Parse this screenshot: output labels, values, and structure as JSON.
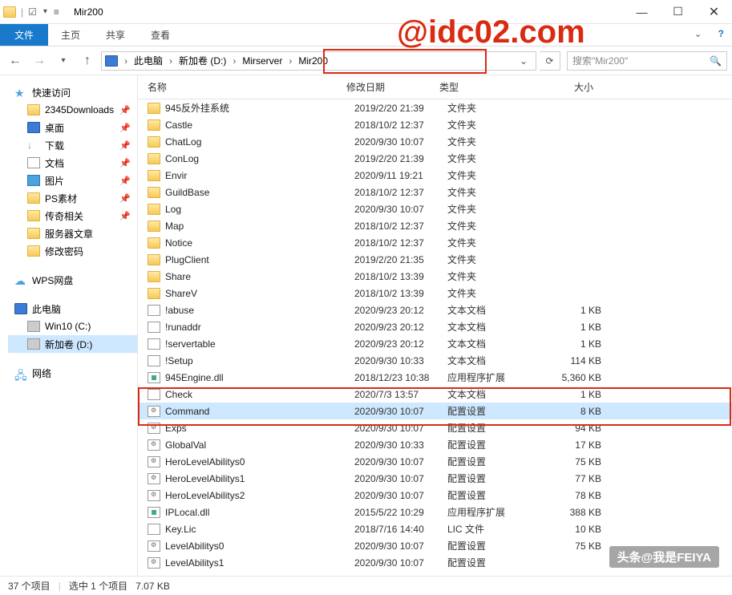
{
  "window": {
    "title": "Mir200"
  },
  "ribbon": {
    "file": "文件",
    "home": "主页",
    "share": "共享",
    "view": "查看"
  },
  "breadcrumb": {
    "pc": "此电脑",
    "drive": "新加卷 (D:)",
    "p1": "Mirserver",
    "p2": "Mir200"
  },
  "search": {
    "placeholder": "搜索\"Mir200\""
  },
  "sidebar": {
    "quick": "快速访问",
    "items1": [
      "2345Downloads",
      "桌面",
      "下载",
      "文档",
      "图片",
      "PS素材",
      "传奇相关",
      "服务器文章",
      "修改密码"
    ],
    "wps": "WPS网盘",
    "thispc": "此电脑",
    "drives": [
      "Win10 (C:)",
      "新加卷 (D:)"
    ],
    "network": "网络"
  },
  "columns": {
    "name": "名称",
    "date": "修改日期",
    "type": "类型",
    "size": "大小"
  },
  "types": {
    "folder": "文件夹",
    "txt": "文本文档",
    "dll": "应用程序扩展",
    "cfg": "配置设置",
    "lic": "LIC 文件"
  },
  "files": [
    {
      "icon": "folder",
      "name": "945反外挂系统",
      "date": "2019/2/20 21:39",
      "typekey": "folder",
      "size": ""
    },
    {
      "icon": "folder",
      "name": "Castle",
      "date": "2018/10/2 12:37",
      "typekey": "folder",
      "size": ""
    },
    {
      "icon": "folder",
      "name": "ChatLog",
      "date": "2020/9/30 10:07",
      "typekey": "folder",
      "size": ""
    },
    {
      "icon": "folder",
      "name": "ConLog",
      "date": "2019/2/20 21:39",
      "typekey": "folder",
      "size": ""
    },
    {
      "icon": "folder",
      "name": "Envir",
      "date": "2020/9/11 19:21",
      "typekey": "folder",
      "size": ""
    },
    {
      "icon": "folder",
      "name": "GuildBase",
      "date": "2018/10/2 12:37",
      "typekey": "folder",
      "size": ""
    },
    {
      "icon": "folder",
      "name": "Log",
      "date": "2020/9/30 10:07",
      "typekey": "folder",
      "size": ""
    },
    {
      "icon": "folder",
      "name": "Map",
      "date": "2018/10/2 12:37",
      "typekey": "folder",
      "size": ""
    },
    {
      "icon": "folder",
      "name": "Notice",
      "date": "2018/10/2 12:37",
      "typekey": "folder",
      "size": ""
    },
    {
      "icon": "folder",
      "name": "PlugClient",
      "date": "2019/2/20 21:35",
      "typekey": "folder",
      "size": ""
    },
    {
      "icon": "folder",
      "name": "Share",
      "date": "2018/10/2 13:39",
      "typekey": "folder",
      "size": ""
    },
    {
      "icon": "folder",
      "name": "ShareV",
      "date": "2018/10/2 13:39",
      "typekey": "folder",
      "size": ""
    },
    {
      "icon": "txt",
      "name": "!abuse",
      "date": "2020/9/23 20:12",
      "typekey": "txt",
      "size": "1 KB"
    },
    {
      "icon": "txt",
      "name": "!runaddr",
      "date": "2020/9/23 20:12",
      "typekey": "txt",
      "size": "1 KB"
    },
    {
      "icon": "txt",
      "name": "!servertable",
      "date": "2020/9/23 20:12",
      "typekey": "txt",
      "size": "1 KB"
    },
    {
      "icon": "txt",
      "name": "!Setup",
      "date": "2020/9/30 10:33",
      "typekey": "txt",
      "size": "114 KB"
    },
    {
      "icon": "dll",
      "name": "945Engine.dll",
      "date": "2018/12/23 10:38",
      "typekey": "dll",
      "size": "5,360 KB"
    },
    {
      "icon": "txt",
      "name": "Check",
      "date": "2020/7/3 13:57",
      "typekey": "txt",
      "size": "1 KB"
    },
    {
      "icon": "cfg",
      "name": "Command",
      "date": "2020/9/30 10:07",
      "typekey": "cfg",
      "size": "8 KB",
      "selected": true
    },
    {
      "icon": "cfg",
      "name": "Exps",
      "date": "2020/9/30 10:07",
      "typekey": "cfg",
      "size": "94 KB"
    },
    {
      "icon": "cfg",
      "name": "GlobalVal",
      "date": "2020/9/30 10:33",
      "typekey": "cfg",
      "size": "17 KB"
    },
    {
      "icon": "cfg",
      "name": "HeroLevelAbilitys0",
      "date": "2020/9/30 10:07",
      "typekey": "cfg",
      "size": "75 KB"
    },
    {
      "icon": "cfg",
      "name": "HeroLevelAbilitys1",
      "date": "2020/9/30 10:07",
      "typekey": "cfg",
      "size": "77 KB"
    },
    {
      "icon": "cfg",
      "name": "HeroLevelAbilitys2",
      "date": "2020/9/30 10:07",
      "typekey": "cfg",
      "size": "78 KB"
    },
    {
      "icon": "dll",
      "name": "IPLocal.dll",
      "date": "2015/5/22 10:29",
      "typekey": "dll",
      "size": "388 KB"
    },
    {
      "icon": "lic",
      "name": "Key.Lic",
      "date": "2018/7/16 14:40",
      "typekey": "lic",
      "size": "10 KB"
    },
    {
      "icon": "cfg",
      "name": "LevelAbilitys0",
      "date": "2020/9/30 10:07",
      "typekey": "cfg",
      "size": "75 KB"
    },
    {
      "icon": "cfg",
      "name": "LevelAbilitys1",
      "date": "2020/9/30 10:07",
      "typekey": "cfg",
      "size": ""
    }
  ],
  "status": {
    "count": "37 个项目",
    "selected": "选中 1 个项目",
    "size": "7.07 KB"
  },
  "watermark1": "@idc02.com",
  "watermark2": "头条@我是FEIYA"
}
